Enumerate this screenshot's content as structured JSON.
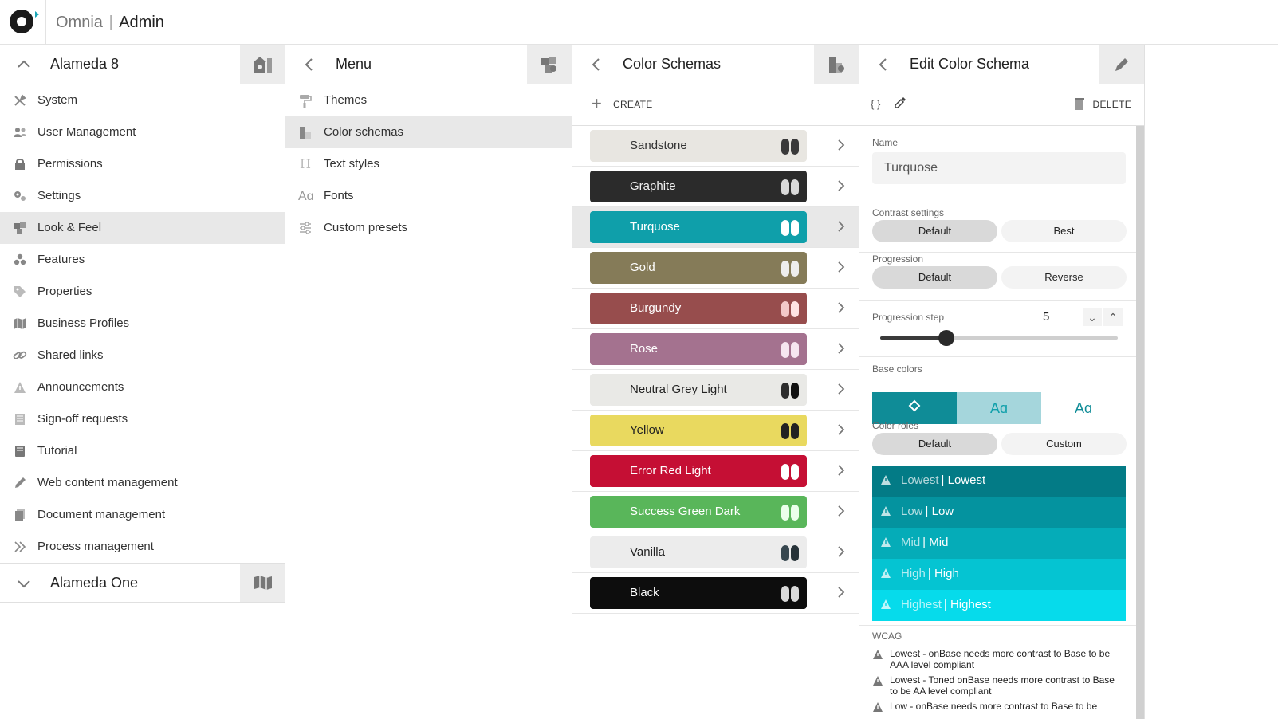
{
  "app": {
    "name": "Omnia",
    "section": "Admin"
  },
  "column1": {
    "tenant_title": "Alameda 8",
    "items": [
      {
        "label": "System",
        "icon": "tools-icon"
      },
      {
        "label": "User Management",
        "icon": "users-icon"
      },
      {
        "label": "Permissions",
        "icon": "lock-icon"
      },
      {
        "label": "Settings",
        "icon": "gears-icon"
      },
      {
        "label": "Look & Feel",
        "icon": "palette-icon",
        "selected": true
      },
      {
        "label": "Features",
        "icon": "cubes-icon"
      },
      {
        "label": "Properties",
        "icon": "tag-icon"
      },
      {
        "label": "Business Profiles",
        "icon": "map-icon"
      },
      {
        "label": "Shared links",
        "icon": "link-icon"
      },
      {
        "label": "Announcements",
        "icon": "warning-icon"
      },
      {
        "label": "Sign-off requests",
        "icon": "list-icon"
      },
      {
        "label": "Tutorial",
        "icon": "book-icon"
      },
      {
        "label": "Web content management",
        "icon": "pen-icon"
      },
      {
        "label": "Document management",
        "icon": "document-icon"
      },
      {
        "label": "Process management",
        "icon": "double-chevron-icon"
      }
    ],
    "second_tenant": "Alameda One"
  },
  "column2": {
    "title": "Menu",
    "items": [
      {
        "label": "Themes",
        "icon": "paint-roller-icon"
      },
      {
        "label": "Color schemas",
        "icon": "color-schema-icon",
        "selected": true
      },
      {
        "label": "Text styles",
        "icon": "heading-icon"
      },
      {
        "label": "Fonts",
        "icon": "font-icon"
      },
      {
        "label": "Custom presets",
        "icon": "sliders-icon"
      }
    ]
  },
  "column3": {
    "title": "Color Schemas",
    "create_label": "CREATE",
    "schemas": [
      {
        "name": "Sandstone",
        "bg": "#e8e6e1",
        "fg": "#333333",
        "sw1": "#3a3a3a",
        "sw2": "#3a3a3a"
      },
      {
        "name": "Graphite",
        "bg": "#2b2b2b",
        "fg": "#f2f2f2",
        "sw1": "#d9d9d9",
        "sw2": "#d9d9d9"
      },
      {
        "name": "Turquose",
        "bg": "#0f9faa",
        "fg": "#ffffff",
        "sw1": "#ffffff",
        "sw2": "#ffffff",
        "selected": true
      },
      {
        "name": "Gold",
        "bg": "#857b58",
        "fg": "#ffffff",
        "sw1": "#eeeeee",
        "sw2": "#eeeeee"
      },
      {
        "name": "Burgundy",
        "bg": "#974d4d",
        "fg": "#ffffff",
        "sw1": "#f3c9c9",
        "sw2": "#ffe3e3"
      },
      {
        "name": "Rose",
        "bg": "#a4728f",
        "fg": "#ffffff",
        "sw1": "#f6e6f0",
        "sw2": "#f6e6f0"
      },
      {
        "name": "Neutral Grey Light",
        "bg": "#e9e9e6",
        "fg": "#222222",
        "sw1": "#2d2d2d",
        "sw2": "#111111"
      },
      {
        "name": "Yellow",
        "bg": "#e9d95f",
        "fg": "#222222",
        "sw1": "#222222",
        "sw2": "#222222"
      },
      {
        "name": "Error Red Light",
        "bg": "#c50f34",
        "fg": "#ffffff",
        "sw1": "#ffffff",
        "sw2": "#ffffff"
      },
      {
        "name": "Success Green Dark",
        "bg": "#59b65a",
        "fg": "#ffffff",
        "sw1": "#eaffea",
        "sw2": "#eaffea"
      },
      {
        "name": "Vanilla",
        "bg": "#ececec",
        "fg": "#222222",
        "sw1": "#37474f",
        "sw2": "#263238"
      },
      {
        "name": "Black",
        "bg": "#0d0d0d",
        "fg": "#ffffff",
        "sw1": "#d9d9d9",
        "sw2": "#d9d9d9"
      }
    ]
  },
  "column4": {
    "title": "Edit Color Schema",
    "delete_label": "DELETE",
    "name_label": "Name",
    "name_value": "Turquose",
    "contrast_label": "Contrast settings",
    "contrast_options": [
      "Default",
      "Best"
    ],
    "progression_label": "Progression",
    "progression_options": [
      "Default",
      "Reverse"
    ],
    "step_label": "Progression step",
    "step_value": "5",
    "step_fraction": 0.28,
    "base_label": "Base colors",
    "roles_label": "Color roles",
    "roles_options": [
      "Default",
      "Custom"
    ],
    "roles": [
      {
        "primary": "Lowest",
        "secondary": "Lowest",
        "bg": "#037b86"
      },
      {
        "primary": "Low",
        "secondary": "Low",
        "bg": "#04939f"
      },
      {
        "primary": "Mid",
        "secondary": "Mid",
        "bg": "#05acb8"
      },
      {
        "primary": "High",
        "secondary": "High",
        "bg": "#05c4d2"
      },
      {
        "primary": "Highest",
        "secondary": "Highest",
        "bg": "#06dbeb"
      }
    ],
    "wcag_label": "WCAG",
    "wcag_items": [
      "Lowest - onBase needs more contrast to Base to be AAA level compliant",
      "Lowest - Toned onBase needs more contrast to Base to be AA level compliant",
      "Low - onBase needs more contrast to Base to be"
    ],
    "base_colors": [
      "#0f8c97",
      "#a5d6dc",
      "#ffffff"
    ],
    "accent": "#0f9faa"
  }
}
